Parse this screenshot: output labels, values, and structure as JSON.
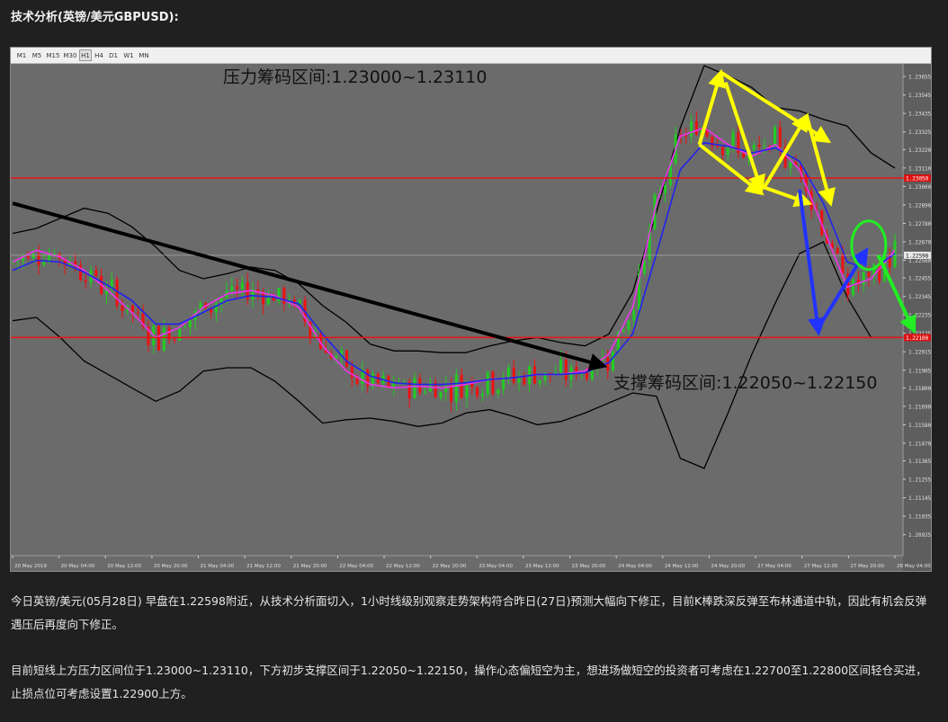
{
  "heading": "技术分析(英镑/美元GBPUSD):",
  "toolbar": {
    "timeframes": [
      "M1",
      "M5",
      "M15",
      "M30",
      "H1",
      "H4",
      "D1",
      "W1",
      "MN"
    ],
    "active": "H1"
  },
  "chart_data": {
    "type": "candlestick",
    "symbol": "GBPUSD",
    "timeframe": "H1",
    "ylim": [
      1.208,
      1.2372
    ],
    "y_ticks": [
      "1.23655",
      "1.23545",
      "1.23435",
      "1.23325",
      "1.23220",
      "1.23110",
      "1.23000",
      "1.22890",
      "1.22780",
      "1.22670",
      "1.22560",
      "1.22455",
      "1.22345",
      "1.22235",
      "1.22125",
      "1.22015",
      "1.21905",
      "1.21800",
      "1.21690",
      "1.21580",
      "1.21470",
      "1.21365",
      "1.21255",
      "1.21145",
      "1.21035",
      "1.20925"
    ],
    "x_ticks": [
      "20 May 2019",
      "20 May 04:00",
      "20 May 12:00",
      "20 May 20:00",
      "21 May 04:00",
      "21 May 12:00",
      "21 May 20:00",
      "22 May 04:00",
      "22 May 12:00",
      "22 May 20:00",
      "23 May 04:00",
      "23 May 12:00",
      "23 May 20:00",
      "24 May 04:00",
      "24 May 12:00",
      "24 May 20:00",
      "27 May 04:00",
      "27 May 12:00",
      "27 May 20:00",
      "28 May 04:00"
    ],
    "resistance_line": 1.2305,
    "support_line": 1.221,
    "current_price": 1.2259,
    "current_price_label": "1.22598",
    "resistance_price_label": "1.23050",
    "support_price_label": "1.22100",
    "annotations": {
      "resistance": "压力筹码区间:1.23000~1.23110",
      "support": "支撑筹码区间:1.22050~1.22150"
    },
    "colors": {
      "background": "#6b6b6b",
      "bull": "#22cc22",
      "bear": "#ee1111",
      "ma_fast": "#ee33ee",
      "ma_slow": "#2222ee",
      "bollinger": "#000000",
      "level_line": "#ee1111",
      "yellow_arrows": "#ffff00",
      "blue_arrows": "#2233ff",
      "green_markup": "#22ee22",
      "trend_arrow": "#000000"
    },
    "bollinger_upper": [
      1.2272,
      1.2275,
      1.2281,
      1.2287,
      1.2284,
      1.2276,
      1.2264,
      1.225,
      1.2245,
      1.2248,
      1.2252,
      1.225,
      1.2242,
      1.2229,
      1.2219,
      1.2206,
      1.2202,
      1.2202,
      1.2201,
      1.2201,
      1.2205,
      1.2208,
      1.221,
      1.2207,
      1.2205,
      1.2212,
      1.2237,
      1.2285,
      1.2335,
      1.2372,
      1.2366,
      1.2359,
      1.2347,
      1.2345,
      1.234,
      1.2336,
      1.232,
      1.2311
    ],
    "bollinger_lower": [
      1.222,
      1.2222,
      1.221,
      1.2196,
      1.2188,
      1.218,
      1.2172,
      1.2178,
      1.219,
      1.2192,
      1.2192,
      1.2184,
      1.2172,
      1.2159,
      1.2161,
      1.2162,
      1.216,
      1.2157,
      1.2159,
      1.2165,
      1.2167,
      1.2163,
      1.2158,
      1.216,
      1.2165,
      1.2171,
      1.2177,
      1.2175,
      1.2138,
      1.2132,
      1.2165,
      1.22,
      1.2231,
      1.226,
      1.2267,
      1.2234,
      1.221,
      1.221
    ],
    "ma_fast": [
      1.2255,
      1.2262,
      1.2258,
      1.225,
      1.2238,
      1.2225,
      1.221,
      1.2216,
      1.2228,
      1.2236,
      1.2238,
      1.2235,
      1.2228,
      1.2205,
      1.219,
      1.2182,
      1.218,
      1.2181,
      1.218,
      1.2182,
      1.2185,
      1.2186,
      1.2188,
      1.2188,
      1.219,
      1.22,
      1.2228,
      1.229,
      1.233,
      1.2335,
      1.2325,
      1.2318,
      1.2325,
      1.231,
      1.2275,
      1.224,
      1.2245,
      1.2262
    ],
    "ma_slow": [
      1.225,
      1.2256,
      1.2255,
      1.2249,
      1.2241,
      1.2232,
      1.2218,
      1.2218,
      1.2225,
      1.2232,
      1.2235,
      1.2234,
      1.223,
      1.2212,
      1.2196,
      1.2187,
      1.2183,
      1.2182,
      1.2182,
      1.2183,
      1.2185,
      1.2186,
      1.2188,
      1.2188,
      1.2189,
      1.2195,
      1.2212,
      1.226,
      1.231,
      1.2326,
      1.2324,
      1.232,
      1.2323,
      1.2315,
      1.229,
      1.2255,
      1.225,
      1.226
    ],
    "trend_line": {
      "from": [
        0,
        1.229
      ],
      "to": [
        24.8,
        1.2193
      ]
    }
  },
  "paragraph1": "今日英镑/美元(05月28日) 早盘在1.22598附近，从技术分析面切入，1小时线级别观察走势架构符合昨日(27日)预测大幅向下修正，目前K棒跌深反弹至布林通道中轨，因此有机会反弹遇压后再度向下修正。",
  "paragraph2": "目前短线上方压力区间位于1.23000~1.23110，下方初步支撑区间于1.22050~1.22150，操作心态偏短空为主，想进场做短空的投资者可考虑在1.22700至1.22800区间轻仓买进，止损点位可考虑设置1.22900上方。"
}
